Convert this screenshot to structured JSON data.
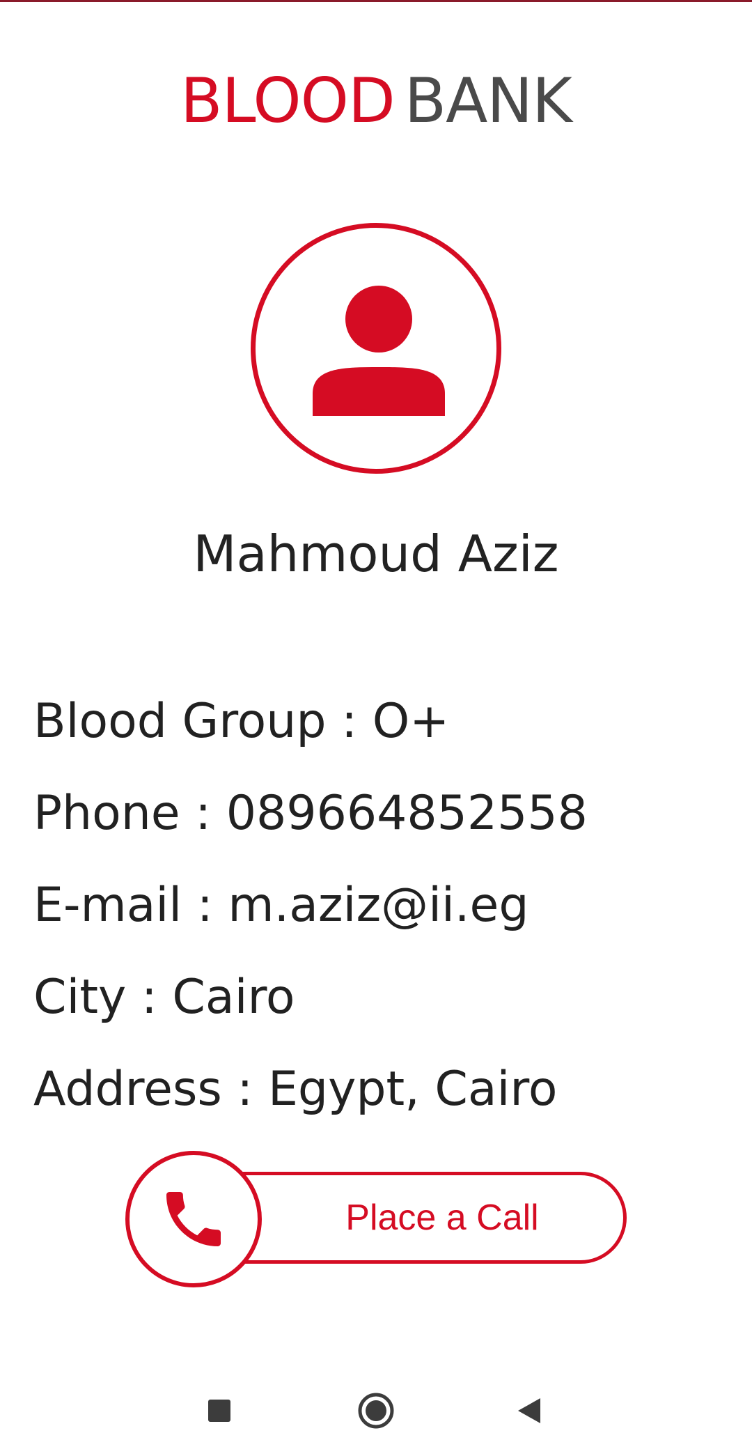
{
  "app": {
    "logo_part1": "BLOOD",
    "logo_part2": "BANK",
    "brand_color": "#d50c23"
  },
  "profile": {
    "name": "Mahmoud Aziz",
    "avatar_icon": "person-icon"
  },
  "details": {
    "blood_group": "Blood Group : O+",
    "phone": "Phone : 089664852558",
    "email": "E-mail : m.aziz@ii.eg",
    "city": "City : Cairo",
    "address": "Address : Egypt, Cairo"
  },
  "call_button": {
    "label": "Place a Call",
    "icon": "phone-icon"
  },
  "navbar": {
    "recents_icon": "square-icon",
    "home_icon": "circle-icon",
    "back_icon": "triangle-back-icon"
  }
}
